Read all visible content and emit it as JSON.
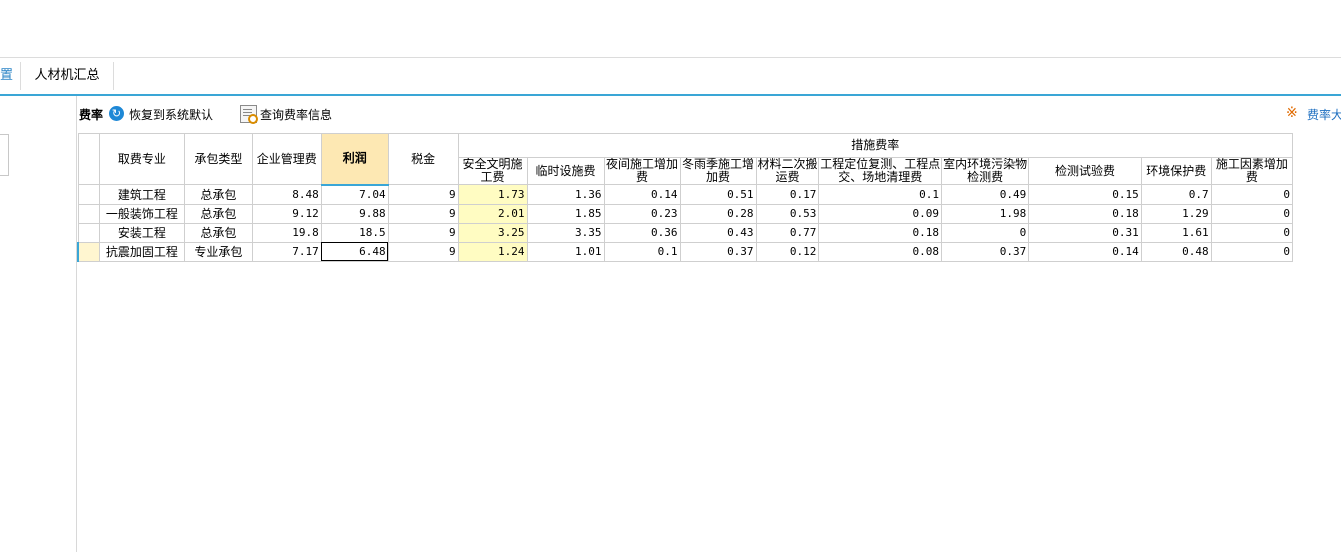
{
  "tabs": [
    {
      "label": "置"
    },
    {
      "label": "人材机汇总"
    }
  ],
  "toolbar": {
    "title": "费率",
    "restore_label": "恢复到系统默认",
    "query_label": "查询费率信息",
    "warn_label": "费率大"
  },
  "table": {
    "group_header": "措施费率",
    "headers": [
      "取费专业",
      "承包类型",
      "企业管理费",
      "利润",
      "税金",
      "安全文明施工费",
      "临时设施费",
      "夜间施工增加费",
      "冬雨季施工增加费",
      "材料二次搬运费",
      "工程定位复测、工程点交、场地清理费",
      "室内环境污染物检测费",
      "检测试验费",
      "环境保护费",
      "施工因素增加费"
    ],
    "rows": [
      {
        "cells": [
          "建筑工程",
          "总承包",
          "8.48",
          "7.04",
          "9",
          "1.73",
          "1.36",
          "0.14",
          "0.51",
          "0.17",
          "0.1",
          "0.49",
          "0.15",
          "0.7",
          "0"
        ]
      },
      {
        "cells": [
          "一般装饰工程",
          "总承包",
          "9.12",
          "9.88",
          "9",
          "2.01",
          "1.85",
          "0.23",
          "0.28",
          "0.53",
          "0.09",
          "1.98",
          "0.18",
          "1.29",
          "0"
        ]
      },
      {
        "cells": [
          "安装工程",
          "总承包",
          "19.8",
          "18.5",
          "9",
          "3.25",
          "3.35",
          "0.36",
          "0.43",
          "0.77",
          "0.18",
          "0",
          "0.31",
          "1.61",
          "0"
        ]
      },
      {
        "cells": [
          "抗震加固工程",
          "专业承包",
          "7.17",
          "6.48",
          "9",
          "1.24",
          "1.01",
          "0.1",
          "0.37",
          "0.12",
          "0.08",
          "0.37",
          "0.14",
          "0.48",
          "0"
        ]
      }
    ]
  }
}
